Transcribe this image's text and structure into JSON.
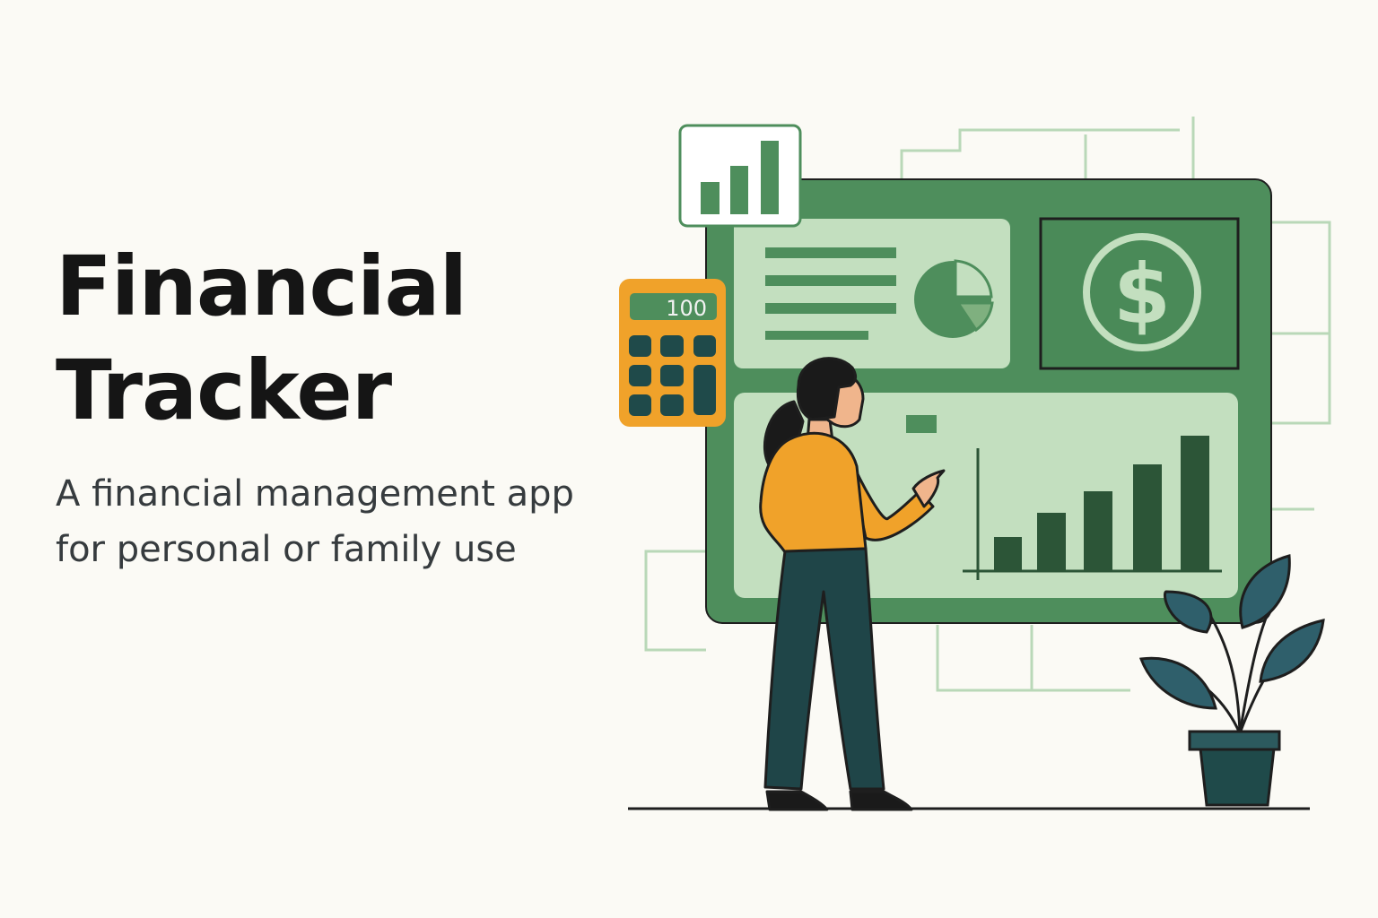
{
  "hero": {
    "title_line1": "Financial",
    "title_line2": "Tracker",
    "subtitle_line1": "A financial management app",
    "subtitle_line2": "for personal or family use"
  },
  "illustration": {
    "calculator_display": "100",
    "currency_symbol": "$",
    "icons": [
      "bar-chart-icon",
      "calculator-icon",
      "pie-chart-icon",
      "dollar-coin-icon",
      "plant-icon",
      "person-figure"
    ]
  },
  "colors": {
    "background": "#fbfaf5",
    "dashboard_green": "#4e8e5c",
    "panel_light": "#c3dfbf",
    "dark_green": "#2c5537",
    "accent_orange": "#f0a22a",
    "dark_teal": "#1f4a4a",
    "text_dark": "#151515"
  }
}
